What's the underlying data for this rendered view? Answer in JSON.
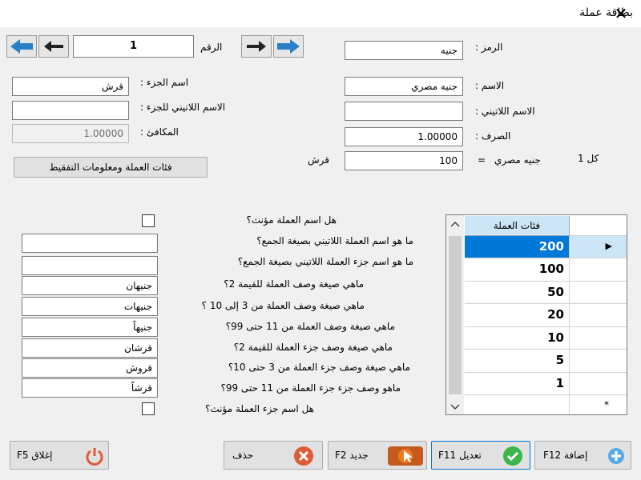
{
  "window": {
    "title": "بطاقة عملة",
    "close_glyph": "✕"
  },
  "nav": {
    "number_label": "الرقم",
    "number_value": "1"
  },
  "form": {
    "symbol_label": "الرمز :",
    "symbol_value": "جنيه",
    "name_label": "الاسم :",
    "name_value": "جنيه مصري",
    "latin_name_label": "الاسم اللاتيني :",
    "latin_name_value": "",
    "rate_label": "الصرف :",
    "rate_value": "1.00000",
    "part_name_label": "اسم الجزء :",
    "part_name_value": "قرش",
    "part_latin_label": "الاسم اللاتيني للجزء :",
    "part_latin_value": "",
    "equiv_label": "المكافئ :",
    "equiv_value": "1.00000",
    "every_one_label": "كل 1",
    "currency_name_inline": "جنيه مصري",
    "equals_sign": "=",
    "sub_units_value": "100",
    "sub_unit_label": "قرش",
    "denoms_button": "فئات العملة ومعلومات التفقيط"
  },
  "questions": [
    {
      "label": "هل اسم العملة مؤنث؟",
      "type": "checkbox"
    },
    {
      "label": "ما هو اسم العملة اللاتيني بصيغة الجمع؟",
      "value": ""
    },
    {
      "label": "ما هو اسم جزء العملة اللاتيني بصيغة الجمع؟",
      "value": ""
    },
    {
      "label": "ماهي صيغة وصف العملة للقيمة 2؟",
      "value": "جنيهان"
    },
    {
      "label": "ماهي صيغة وصف العملة من 3 إلى 10 ؟",
      "value": "جنيهات"
    },
    {
      "label": "ماهي صيغة وصف العملة من 11 حتى 99؟",
      "value": "جنيهاً"
    },
    {
      "label": "ماهي صيغة وصف جزء العملة للقيمة 2؟",
      "value": "قرشان"
    },
    {
      "label": "ماهي صيغة وصف جزء العملة من 3 حتى 10؟",
      "value": "قروش"
    },
    {
      "label": "ماهو وصف جزء جزء العملة من 11 حتى 99؟",
      "value": "قرشاً"
    },
    {
      "label": "هل اسم جزء العملة مؤنث؟",
      "type": "checkbox"
    }
  ],
  "grid": {
    "header": "فئات العملة",
    "rows": [
      "200",
      "100",
      "50",
      "20",
      "10",
      "5",
      "1"
    ],
    "new_row_marker": "*",
    "current_marker": "▶"
  },
  "buttons": {
    "add": "إضافة F12",
    "edit": "تعديل F11",
    "new": "جديد F2",
    "delete": "حذف",
    "close": "إغلاق F5"
  },
  "colors": {
    "selected": "#0078d7",
    "header": "#cde6f7",
    "nav_arrow": "#2a80c8",
    "green": "#3cb64a",
    "red": "#e05a3a",
    "orange": "#f07b1f"
  }
}
